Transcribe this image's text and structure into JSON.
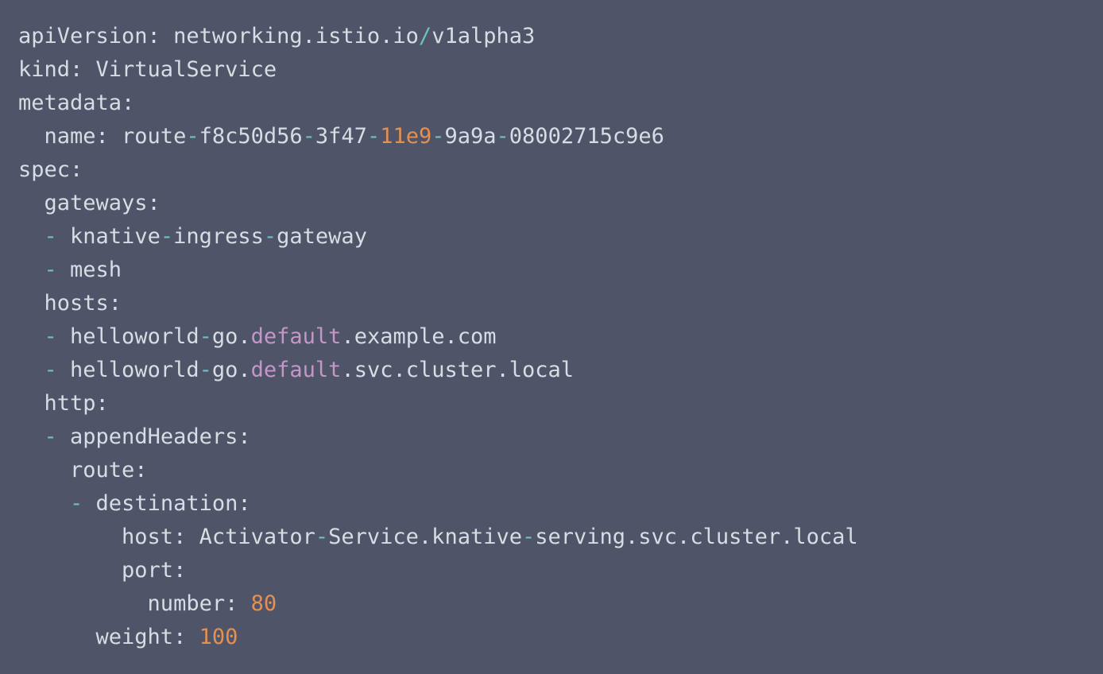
{
  "editor": {
    "background": "#4f5468",
    "colors": {
      "plain": "#d8dce3",
      "operator": "#6bc1c4",
      "number": "#e39051",
      "keyword": "#c497c8"
    },
    "lines": [
      [
        {
          "t": "plain",
          "v": "apiVersion: networking.istio.io"
        },
        {
          "t": "op",
          "v": "/"
        },
        {
          "t": "plain",
          "v": "v1alpha3"
        }
      ],
      [
        {
          "t": "plain",
          "v": "kind: VirtualService"
        }
      ],
      [
        {
          "t": "plain",
          "v": "metadata:"
        }
      ],
      [
        {
          "t": "plain",
          "v": "  name: route"
        },
        {
          "t": "op",
          "v": "-"
        },
        {
          "t": "plain",
          "v": "f8c50d56"
        },
        {
          "t": "op",
          "v": "-"
        },
        {
          "t": "plain",
          "v": "3f47"
        },
        {
          "t": "op",
          "v": "-"
        },
        {
          "t": "num",
          "v": "11e9"
        },
        {
          "t": "op",
          "v": "-"
        },
        {
          "t": "plain",
          "v": "9a9a"
        },
        {
          "t": "op",
          "v": "-"
        },
        {
          "t": "plain",
          "v": "08002715c9e6"
        }
      ],
      [
        {
          "t": "plain",
          "v": "spec:"
        }
      ],
      [
        {
          "t": "plain",
          "v": "  gateways:"
        }
      ],
      [
        {
          "t": "plain",
          "v": "  "
        },
        {
          "t": "op",
          "v": "-"
        },
        {
          "t": "plain",
          "v": " knative"
        },
        {
          "t": "op",
          "v": "-"
        },
        {
          "t": "plain",
          "v": "ingress"
        },
        {
          "t": "op",
          "v": "-"
        },
        {
          "t": "plain",
          "v": "gateway"
        }
      ],
      [
        {
          "t": "plain",
          "v": "  "
        },
        {
          "t": "op",
          "v": "-"
        },
        {
          "t": "plain",
          "v": " mesh"
        }
      ],
      [
        {
          "t": "plain",
          "v": "  hosts:"
        }
      ],
      [
        {
          "t": "plain",
          "v": "  "
        },
        {
          "t": "op",
          "v": "-"
        },
        {
          "t": "plain",
          "v": " helloworld"
        },
        {
          "t": "op",
          "v": "-"
        },
        {
          "t": "plain",
          "v": "go."
        },
        {
          "t": "kw",
          "v": "default"
        },
        {
          "t": "plain",
          "v": ".example.com"
        }
      ],
      [
        {
          "t": "plain",
          "v": "  "
        },
        {
          "t": "op",
          "v": "-"
        },
        {
          "t": "plain",
          "v": " helloworld"
        },
        {
          "t": "op",
          "v": "-"
        },
        {
          "t": "plain",
          "v": "go."
        },
        {
          "t": "kw",
          "v": "default"
        },
        {
          "t": "plain",
          "v": ".svc.cluster.local"
        }
      ],
      [
        {
          "t": "plain",
          "v": "  http:"
        }
      ],
      [
        {
          "t": "plain",
          "v": "  "
        },
        {
          "t": "op",
          "v": "-"
        },
        {
          "t": "plain",
          "v": " appendHeaders:"
        }
      ],
      [
        {
          "t": "plain",
          "v": "    route:"
        }
      ],
      [
        {
          "t": "plain",
          "v": "    "
        },
        {
          "t": "op",
          "v": "-"
        },
        {
          "t": "plain",
          "v": " destination:"
        }
      ],
      [
        {
          "t": "plain",
          "v": "        host: Activator"
        },
        {
          "t": "op",
          "v": "-"
        },
        {
          "t": "plain",
          "v": "Service.knative"
        },
        {
          "t": "op",
          "v": "-"
        },
        {
          "t": "plain",
          "v": "serving.svc.cluster.local"
        }
      ],
      [
        {
          "t": "plain",
          "v": "        port:"
        }
      ],
      [
        {
          "t": "plain",
          "v": "          number: "
        },
        {
          "t": "num",
          "v": "80"
        }
      ],
      [
        {
          "t": "plain",
          "v": "      weight: "
        },
        {
          "t": "num",
          "v": "100"
        }
      ]
    ]
  }
}
